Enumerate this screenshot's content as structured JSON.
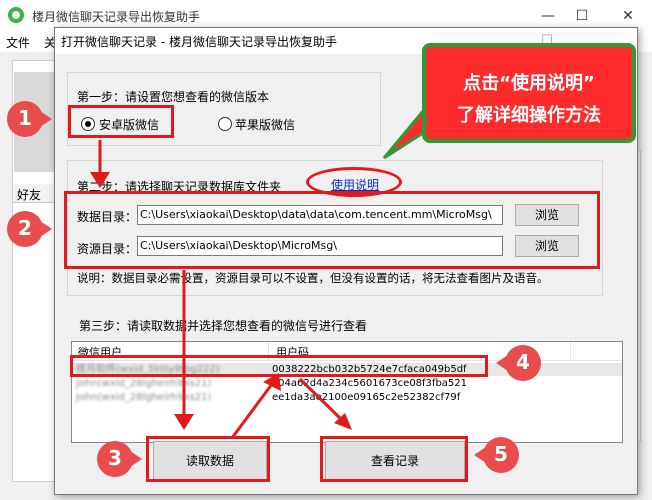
{
  "main_window": {
    "title": "楼月微信聊天记录导出恢复助手",
    "menu": [
      "文件",
      "关"
    ],
    "friend_header": "好友",
    "controls": [
      "—",
      "☐",
      "✕"
    ]
  },
  "dialog": {
    "title": "打开微信聊天记录 - 楼月微信聊天记录导出恢复助手",
    "step1": {
      "label": "第一步：请设置您想查看的微信版本",
      "option_android": "安卓版微信",
      "option_ios": "苹果版微信",
      "selected": "option_android"
    },
    "step2": {
      "label": "第二步：请选择聊天记录数据库文件夹",
      "help_link": "使用说明",
      "data_dir_label": "数据目录：",
      "data_dir_value": "C:\\Users\\xiaokai\\Desktop\\data\\data\\com.tencent.mm\\MicroMsg\\",
      "res_dir_label": "资源目录：",
      "res_dir_value": "C:\\Users\\xiaokai\\Desktop\\MicroMsg\\",
      "browse_label": "浏览",
      "note": "说明：数据目录必需设置，资源目录可以不设置，但没有设置的话，将无法查看图片及语音。"
    },
    "step3": {
      "label": "第三步：请读取数据并选择您想查看的微信号进行查看",
      "columns": [
        "微信用户",
        "用户码"
      ],
      "rows": [
        {
          "user": "楼月软件(wxid_5ktty9fbg222)",
          "code": "0038222bcb032b5724e7cfaca049b5df"
        },
        {
          "user": "John(wxid_28lgheirh9xs21)",
          "code": "a04a62d4a234c5601673ce08f3fba521"
        },
        {
          "user": "John(wxid_28lgheirh9xs21)",
          "code": "ee1da3ae2100e09165c2e52382cf79f"
        }
      ]
    },
    "read_button": "读取数据",
    "view_button": "查看记录"
  },
  "annotations": {
    "callout_line1": "点击“使用说明”",
    "callout_line2": "了解详细操作方法",
    "badges": [
      "1",
      "2",
      "3",
      "4",
      "5"
    ],
    "accent_color": "#e01b1b",
    "callout_border_color": "#2e9c35"
  }
}
